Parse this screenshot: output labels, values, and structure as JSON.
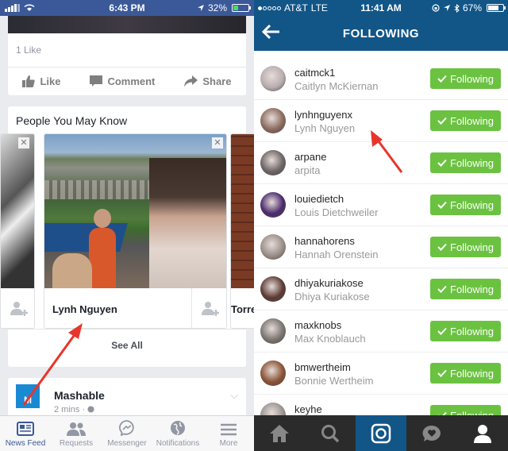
{
  "facebook": {
    "status": {
      "time": "6:43 PM",
      "battery": "32%"
    },
    "post": {
      "likes": "1 Like",
      "actions": [
        "Like",
        "Comment",
        "Share"
      ]
    },
    "pymk": {
      "title": "People You May Know",
      "people": [
        {
          "name": "Lynh Nguyen"
        },
        {
          "name": "Torre"
        }
      ],
      "see_all": "See All"
    },
    "mashable": {
      "logo_letter": "M",
      "name": "Mashable",
      "meta": "2 mins ·"
    },
    "tabs": [
      "News Feed",
      "Requests",
      "Messenger",
      "Notifications",
      "More"
    ],
    "colors": {
      "brand": "#3b5998"
    }
  },
  "instagram": {
    "status": {
      "carrier": "AT&T",
      "network": "LTE",
      "time": "11:41 AM",
      "battery": "67%"
    },
    "title": "FOLLOWING",
    "follow_label": "Following",
    "users": [
      {
        "username": "caitmck1",
        "fullname": "Caitlyn McKiernan",
        "avatar": "#b8aeb0"
      },
      {
        "username": "lynhnguyenx",
        "fullname": "Lynh Nguyen",
        "avatar": "#8a6b5e"
      },
      {
        "username": "arpane",
        "fullname": "arpita",
        "avatar": "#6d6466"
      },
      {
        "username": "louiedietch",
        "fullname": "Louis Dietchweiler",
        "avatar": "#4b2a6e"
      },
      {
        "username": "hannahorens",
        "fullname": "Hannah Orenstein",
        "avatar": "#9c8f8a"
      },
      {
        "username": "dhiyakuriakose",
        "fullname": "Dhiya Kuriakose",
        "avatar": "#5c3a33"
      },
      {
        "username": "maxknobs",
        "fullname": "Max Knoblauch",
        "avatar": "#7a7570"
      },
      {
        "username": "bmwertheim",
        "fullname": "Bonnie Wertheim",
        "avatar": "#8a5236"
      },
      {
        "username": "keyhe",
        "fullname": "",
        "avatar": "#9a9490"
      }
    ],
    "colors": {
      "header": "#125688",
      "follow_button": "#6bc241"
    }
  }
}
